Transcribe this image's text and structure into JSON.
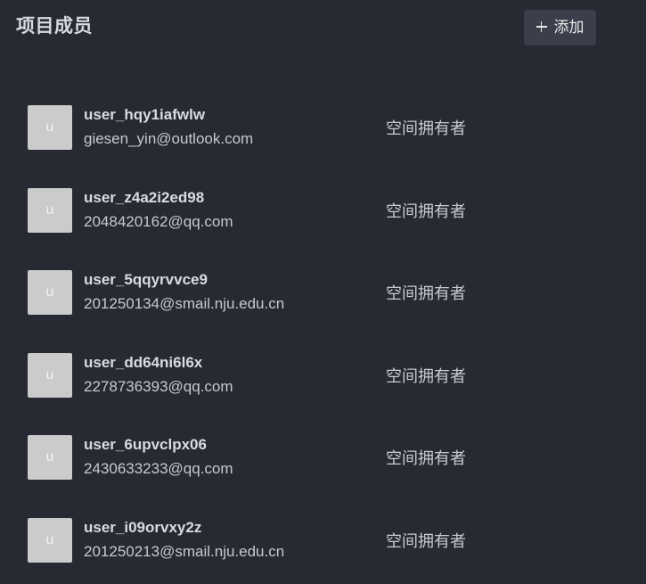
{
  "header": {
    "title": "项目成员",
    "add_label": "添加"
  },
  "members": [
    {
      "avatar": "u",
      "name": "user_hqy1iafwlw",
      "email": "giesen_yin@outlook.com",
      "role": "空间拥有者"
    },
    {
      "avatar": "u",
      "name": "user_z4a2i2ed98",
      "email": "2048420162@qq.com",
      "role": "空间拥有者"
    },
    {
      "avatar": "u",
      "name": "user_5qqyrvvce9",
      "email": "201250134@smail.nju.edu.cn",
      "role": "空间拥有者"
    },
    {
      "avatar": "u",
      "name": "user_dd64ni6l6x",
      "email": "2278736393@qq.com",
      "role": "空间拥有者"
    },
    {
      "avatar": "u",
      "name": "user_6upvclpx06",
      "email": "2430633233@qq.com",
      "role": "空间拥有者"
    },
    {
      "avatar": "u",
      "name": "user_i09orvxy2z",
      "email": "201250213@smail.nju.edu.cn",
      "role": "空间拥有者"
    }
  ]
}
